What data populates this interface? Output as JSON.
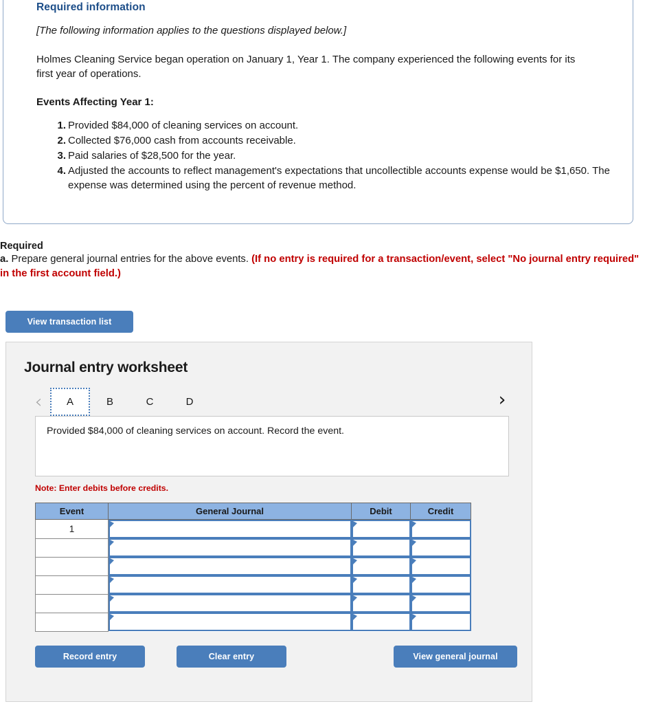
{
  "required_information": {
    "title": "Required information",
    "applies_note": "[The following information applies to the questions displayed below.]",
    "intro": "Holmes Cleaning Service began operation on January 1, Year 1. The company experienced the following events for its first year of operations.",
    "events_heading": "Events Affecting Year 1:",
    "events": [
      {
        "num": "1.",
        "text": "Provided $84,000 of cleaning services on account."
      },
      {
        "num": "2.",
        "text": "Collected $76,000 cash from accounts receivable."
      },
      {
        "num": "3.",
        "text": "Paid salaries of $28,500 for the year."
      },
      {
        "num": "4.",
        "text": "Adjusted the accounts to reflect management's expectations that uncollectible accounts expense would be $1,650. The expense was determined using the percent of revenue method."
      }
    ]
  },
  "required_section": {
    "label": "Required",
    "item_letter": "a.",
    "item_text": "Prepare general journal entries for the above events.",
    "red_note": "(If no entry is required for a transaction/event, select \"No journal entry required\" in the first account field.)",
    "view_transaction_list_label": "View transaction list"
  },
  "worksheet": {
    "title": "Journal entry worksheet",
    "prev_icon": "chevron-left-icon",
    "next_icon": "chevron-right-icon",
    "tabs": [
      {
        "label": "A",
        "active": true
      },
      {
        "label": "B",
        "active": false
      },
      {
        "label": "C",
        "active": false
      },
      {
        "label": "D",
        "active": false
      }
    ],
    "description": "Provided $84,000 of cleaning services on account. Record the event.",
    "note": "Note: Enter debits before credits.",
    "table": {
      "columns": [
        "Event",
        "General Journal",
        "Debit",
        "Credit"
      ],
      "rows": [
        {
          "event": "1",
          "general_journal": "",
          "debit": "",
          "credit": ""
        },
        {
          "event": "",
          "general_journal": "",
          "debit": "",
          "credit": ""
        },
        {
          "event": "",
          "general_journal": "",
          "debit": "",
          "credit": ""
        },
        {
          "event": "",
          "general_journal": "",
          "debit": "",
          "credit": ""
        },
        {
          "event": "",
          "general_journal": "",
          "debit": "",
          "credit": ""
        },
        {
          "event": "",
          "general_journal": "",
          "debit": "",
          "credit": ""
        }
      ]
    },
    "actions": {
      "record_entry": "Record entry",
      "clear_entry": "Clear entry",
      "view_general_journal": "View general journal"
    }
  },
  "colors": {
    "accent_blue": "#4a7ebb",
    "header_blue": "#8db3e2",
    "title_blue": "#1d4e89",
    "alert_red": "#c00000",
    "panel_gray": "#f2f2f2"
  }
}
